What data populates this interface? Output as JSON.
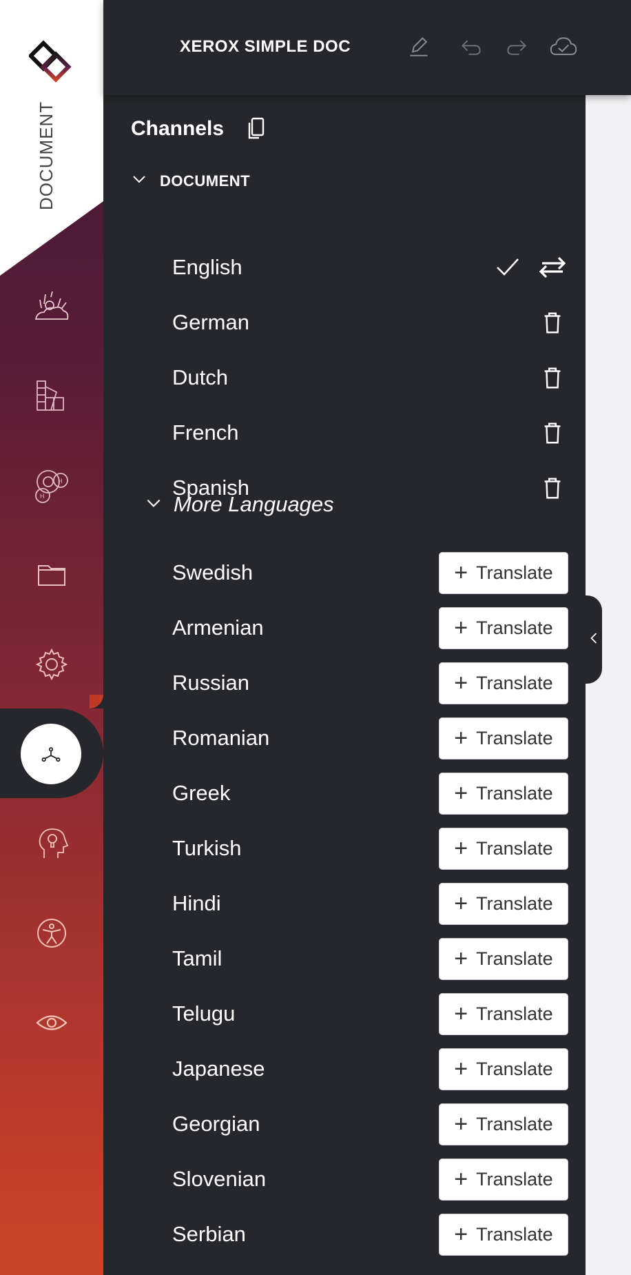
{
  "app": {
    "rail_label": "DOCUMENT",
    "title": "XEROX SIMPLE DOC"
  },
  "colors": {
    "panel": "#25272c",
    "rail_top": "#3c1636",
    "rail_bottom": "#cc4428"
  },
  "header_icons": [
    "edit-icon",
    "undo-icon",
    "redo-icon",
    "cloud-check-icon"
  ],
  "rail_icons": [
    "landscape-icon",
    "swatch-icon",
    "headings-icon",
    "folder-icon",
    "gear-icon",
    "network-icon",
    "idea-head-icon",
    "accessibility-icon",
    "eye-icon"
  ],
  "panel": {
    "title": "Channels",
    "section": "DOCUMENT",
    "active_languages": [
      {
        "name": "English",
        "primary": true
      },
      {
        "name": "German"
      },
      {
        "name": "Dutch"
      },
      {
        "name": "French"
      },
      {
        "name": "Spanish"
      }
    ],
    "more_label": "More Languages",
    "translate_label": "Translate",
    "more_languages": [
      "Swedish",
      "Armenian",
      "Russian",
      "Romanian",
      "Greek",
      "Turkish",
      "Hindi",
      "Tamil",
      "Telugu",
      "Japanese",
      "Georgian",
      "Slovenian",
      "Serbian"
    ]
  }
}
